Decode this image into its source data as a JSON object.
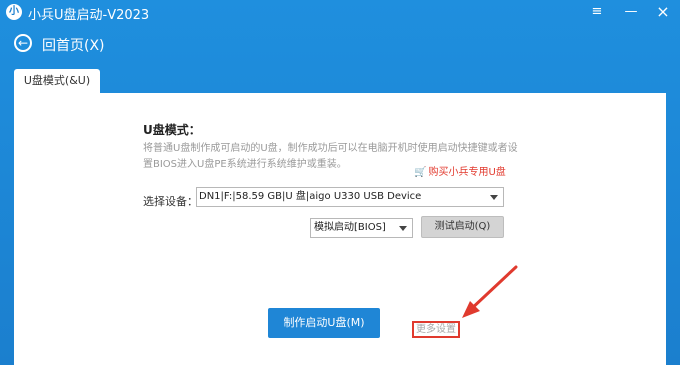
{
  "titlebar": {
    "logo_icon": "小",
    "title": "小兵U盘启动-V2023",
    "menu_icon": "≡",
    "minimize_icon": "—",
    "close_icon": "×"
  },
  "nav": {
    "back_icon": "←",
    "back_label": "回首页(X)"
  },
  "tab": {
    "label": "U盘模式(&U)"
  },
  "panel": {
    "section_title": "U盘模式：",
    "description": "将普通U盘制作成可启动的U盘，制作成功后可以在电脑开机时使用启动快捷键或者设置BIOS进入U盘PE系统进行系统维护或重装。",
    "buy_link": "购买小兵专用U盘",
    "cart_icon": "🛒",
    "device_label": "选择设备：",
    "device_value": "DN1|F:|58.59 GB|U 盘|aigo U330 USB Device",
    "mode_value": "模拟启动[BIOS]",
    "test_button": "测试启动(Q)",
    "make_button": "制作启动U盘(M)",
    "more_settings": "更多设置"
  },
  "colors": {
    "brand_blue": "#1f8fde",
    "button_blue": "#1f86d6",
    "annotation_red": "#e03a2e"
  }
}
